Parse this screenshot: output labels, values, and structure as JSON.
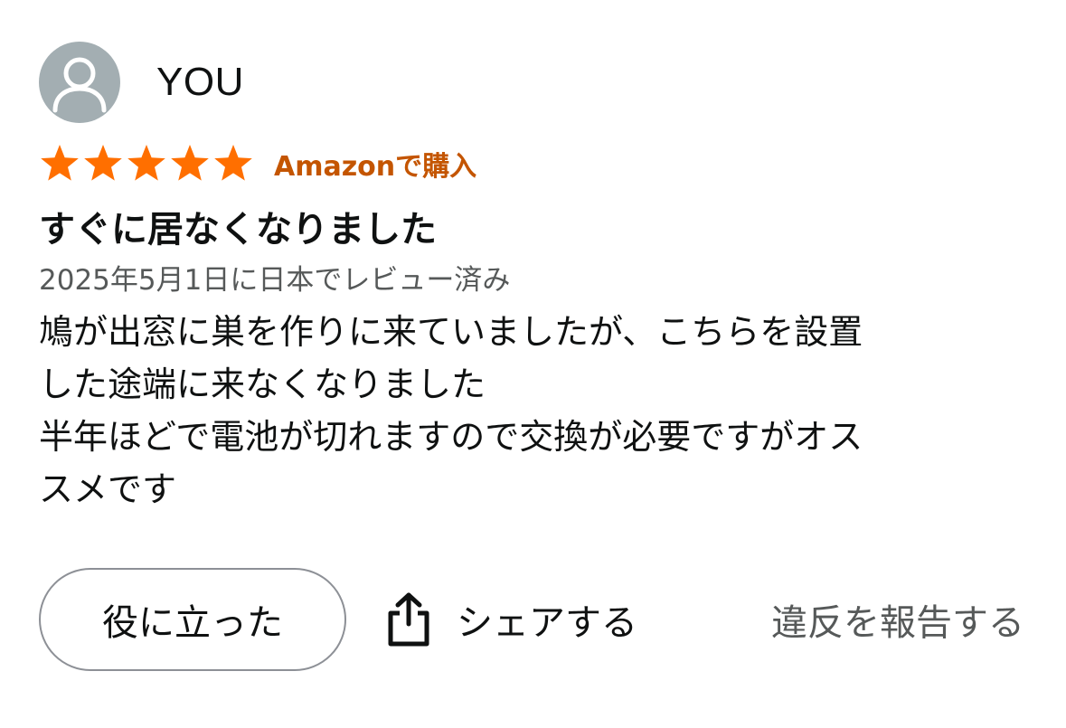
{
  "profile": {
    "name": "YOU",
    "avatar_icon": "user-silhouette-icon"
  },
  "rating": {
    "stars": 5,
    "max": 5,
    "star_color": "#ff6f00",
    "verified_label": "Amazonで購入",
    "verified_color": "#c45500"
  },
  "review": {
    "title": "すぐに居なくなりました",
    "date": "2025年5月1日に日本でレビュー済み",
    "body_lines": [
      "鳩が出窓に巣を作りに来ていましたが、こちらを設置",
      "した途端に来なくなりました",
      "半年ほどで電池が切れますので交換が必要ですがオス",
      "スメです"
    ]
  },
  "actions": {
    "helpful_label": "役に立った",
    "share_label": "シェアする",
    "share_icon": "share-icon",
    "report_label": "違反を報告する"
  }
}
